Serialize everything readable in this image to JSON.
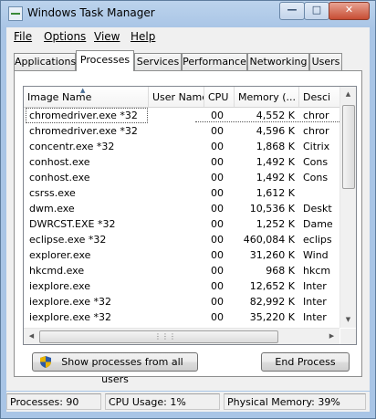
{
  "window": {
    "title": "Windows Task Manager"
  },
  "menu": [
    "File",
    "Options",
    "View",
    "Help"
  ],
  "tabs": [
    "Applications",
    "Processes",
    "Services",
    "Performance",
    "Networking",
    "Users"
  ],
  "active_tab": "Processes",
  "columns": {
    "name": "Image Name",
    "user": "User Name",
    "cpu": "CPU",
    "mem": "Memory (...",
    "desc": "Desci"
  },
  "processes": [
    {
      "name": "chromedriver.exe *32",
      "user": "",
      "cpu": "00",
      "mem": "4,552 K",
      "desc": "chror"
    },
    {
      "name": "chromedriver.exe *32",
      "user": "",
      "cpu": "00",
      "mem": "4,596 K",
      "desc": "chror"
    },
    {
      "name": "concentr.exe *32",
      "user": "",
      "cpu": "00",
      "mem": "1,868 K",
      "desc": "Citrix"
    },
    {
      "name": "conhost.exe",
      "user": "",
      "cpu": "00",
      "mem": "1,492 K",
      "desc": "Cons"
    },
    {
      "name": "conhost.exe",
      "user": "",
      "cpu": "00",
      "mem": "1,492 K",
      "desc": "Cons"
    },
    {
      "name": "csrss.exe",
      "user": "",
      "cpu": "00",
      "mem": "1,612 K",
      "desc": ""
    },
    {
      "name": "dwm.exe",
      "user": "",
      "cpu": "00",
      "mem": "10,536 K",
      "desc": "Deskt"
    },
    {
      "name": "DWRCST.EXE *32",
      "user": "",
      "cpu": "00",
      "mem": "1,252 K",
      "desc": "Dame"
    },
    {
      "name": "eclipse.exe *32",
      "user": "",
      "cpu": "00",
      "mem": "460,084 K",
      "desc": "eclips"
    },
    {
      "name": "explorer.exe",
      "user": "",
      "cpu": "00",
      "mem": "31,260 K",
      "desc": "Wind"
    },
    {
      "name": "hkcmd.exe",
      "user": "",
      "cpu": "00",
      "mem": "968 K",
      "desc": "hkcm"
    },
    {
      "name": "iexplore.exe",
      "user": "",
      "cpu": "00",
      "mem": "12,652 K",
      "desc": "Inter"
    },
    {
      "name": "iexplore.exe *32",
      "user": "",
      "cpu": "00",
      "mem": "82,992 K",
      "desc": "Inter"
    },
    {
      "name": "iexplore.exe *32",
      "user": "",
      "cpu": "00",
      "mem": "35,220 K",
      "desc": "Inter"
    }
  ],
  "buttons": {
    "show_all": "Show processes from all users",
    "end_process": "End Process"
  },
  "status": {
    "processes": "Processes: 90",
    "cpu": "CPU Usage: 1%",
    "memory": "Physical Memory: 39%"
  },
  "icons": [
    "app-icon",
    "minimize-icon",
    "maximize-icon",
    "close-icon",
    "sort-ascending-icon",
    "uac-shield-icon",
    "scroll-up-icon",
    "scroll-down-icon",
    "scroll-left-icon",
    "scroll-right-icon"
  ]
}
